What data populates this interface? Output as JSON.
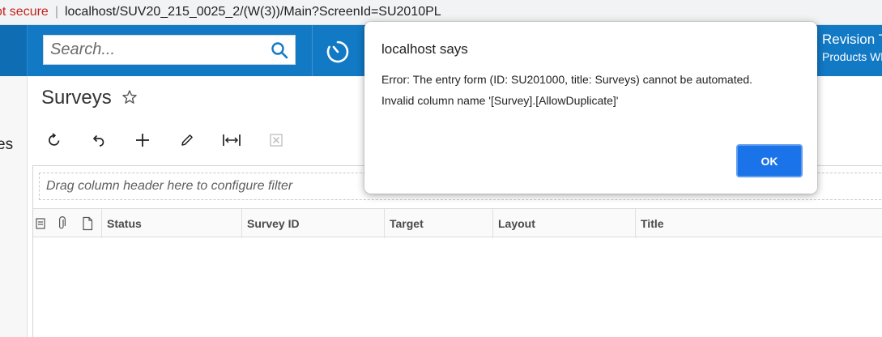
{
  "browser": {
    "security_label": "ot secure",
    "separator": "|",
    "url": "localhost/SUV20_215_0025_2/(W(3))/Main?ScreenId=SU2010PL"
  },
  "topbar": {
    "search_placeholder": "Search...",
    "company_name": "Revision Tw",
    "company_sub": "Products Who"
  },
  "leftnav": {
    "partial_text": "es"
  },
  "page": {
    "title": "Surveys"
  },
  "toolbar": {
    "buttons": [
      "refresh-icon",
      "undo-icon",
      "plus-icon",
      "pencil-icon",
      "fit-width-icon",
      "excel-export-icon"
    ]
  },
  "grid": {
    "filter_hint": "Drag column header here to configure filter",
    "columns": [
      "Status",
      "Survey ID",
      "Target",
      "Layout",
      "Title"
    ],
    "rows": []
  },
  "dialog": {
    "title": "localhost says",
    "message": "Error: The entry form (ID: SU201000, title: Surveys) cannot be automated. Invalid column name '[Survey].[AllowDuplicate]'",
    "ok_label": "OK"
  },
  "colors": {
    "topbar": "#1279c5",
    "ok_button": "#1a73e8",
    "not_secure": "#c5221f"
  }
}
